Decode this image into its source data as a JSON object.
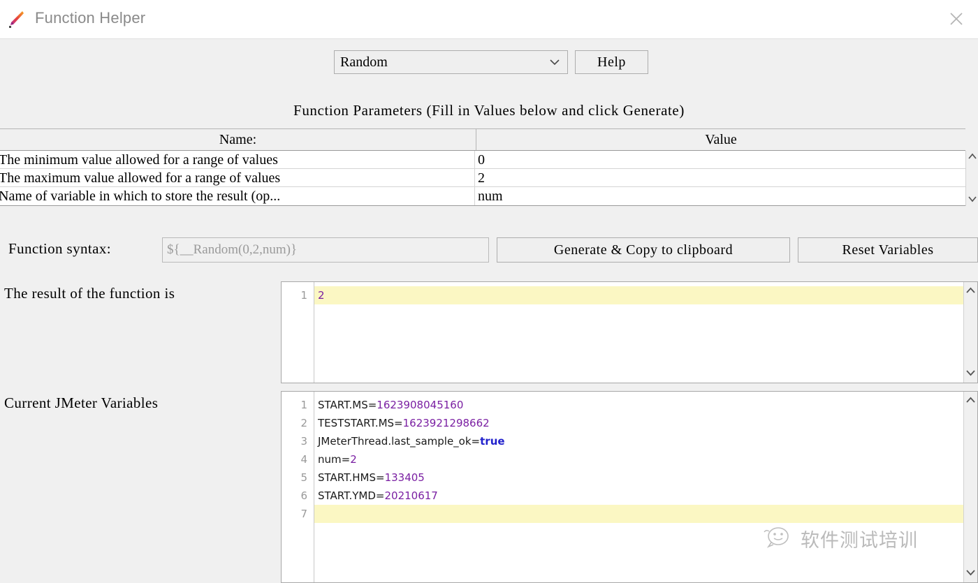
{
  "window": {
    "title": "Function Helper",
    "app_icon": "jmeter-feather-icon",
    "close_icon": "close-icon"
  },
  "toolbar": {
    "function_select_value": "Random",
    "function_select_icon": "chevron-down-icon",
    "help_label": "Help"
  },
  "parameters": {
    "caption": "Function Parameters (Fill in Values below and click Generate)",
    "columns": [
      "Name:",
      "Value"
    ],
    "rows": [
      {
        "name": "The minimum value allowed for a range of values",
        "value": "0"
      },
      {
        "name": "The maximum value allowed for a range of values",
        "value": "2"
      },
      {
        "name": "Name of variable in which to store the result (op...",
        "value": "num"
      }
    ]
  },
  "syntax": {
    "label": "Function syntax:",
    "value": "${__Random(0,2,num)}",
    "generate_label": "Generate & Copy to clipboard",
    "reset_label": "Reset Variables"
  },
  "result": {
    "label": "The result of the function is",
    "lines": [
      {
        "num": "1",
        "text": "2",
        "type": "num",
        "highlight": true
      }
    ]
  },
  "variables": {
    "label": "Current JMeter Variables",
    "lines": [
      {
        "num": "1",
        "key": "START.MS=",
        "value": "1623908045160",
        "type": "num",
        "highlight": false
      },
      {
        "num": "2",
        "key": "TESTSTART.MS=",
        "value": "1623921298662",
        "type": "num",
        "highlight": false
      },
      {
        "num": "3",
        "key": "JMeterThread.last_sample_ok=",
        "value": "true",
        "type": "bool",
        "highlight": false
      },
      {
        "num": "4",
        "key": "num=",
        "value": "2",
        "type": "num",
        "highlight": false
      },
      {
        "num": "5",
        "key": "START.HMS=",
        "value": "133405",
        "type": "num",
        "highlight": false
      },
      {
        "num": "6",
        "key": "START.YMD=",
        "value": "20210617",
        "type": "num",
        "highlight": false
      },
      {
        "num": "7",
        "key": "",
        "value": "",
        "type": "none",
        "highlight": true
      }
    ]
  },
  "watermark": {
    "text": "软件测试培训",
    "icon": "wechat-smiley-icon"
  },
  "colors": {
    "background": "#f0f0f0",
    "highlight": "#fbf7c3",
    "number_token": "#7a1fa2",
    "boolean_token": "#2222cc",
    "title_text": "#8a8a8a"
  }
}
